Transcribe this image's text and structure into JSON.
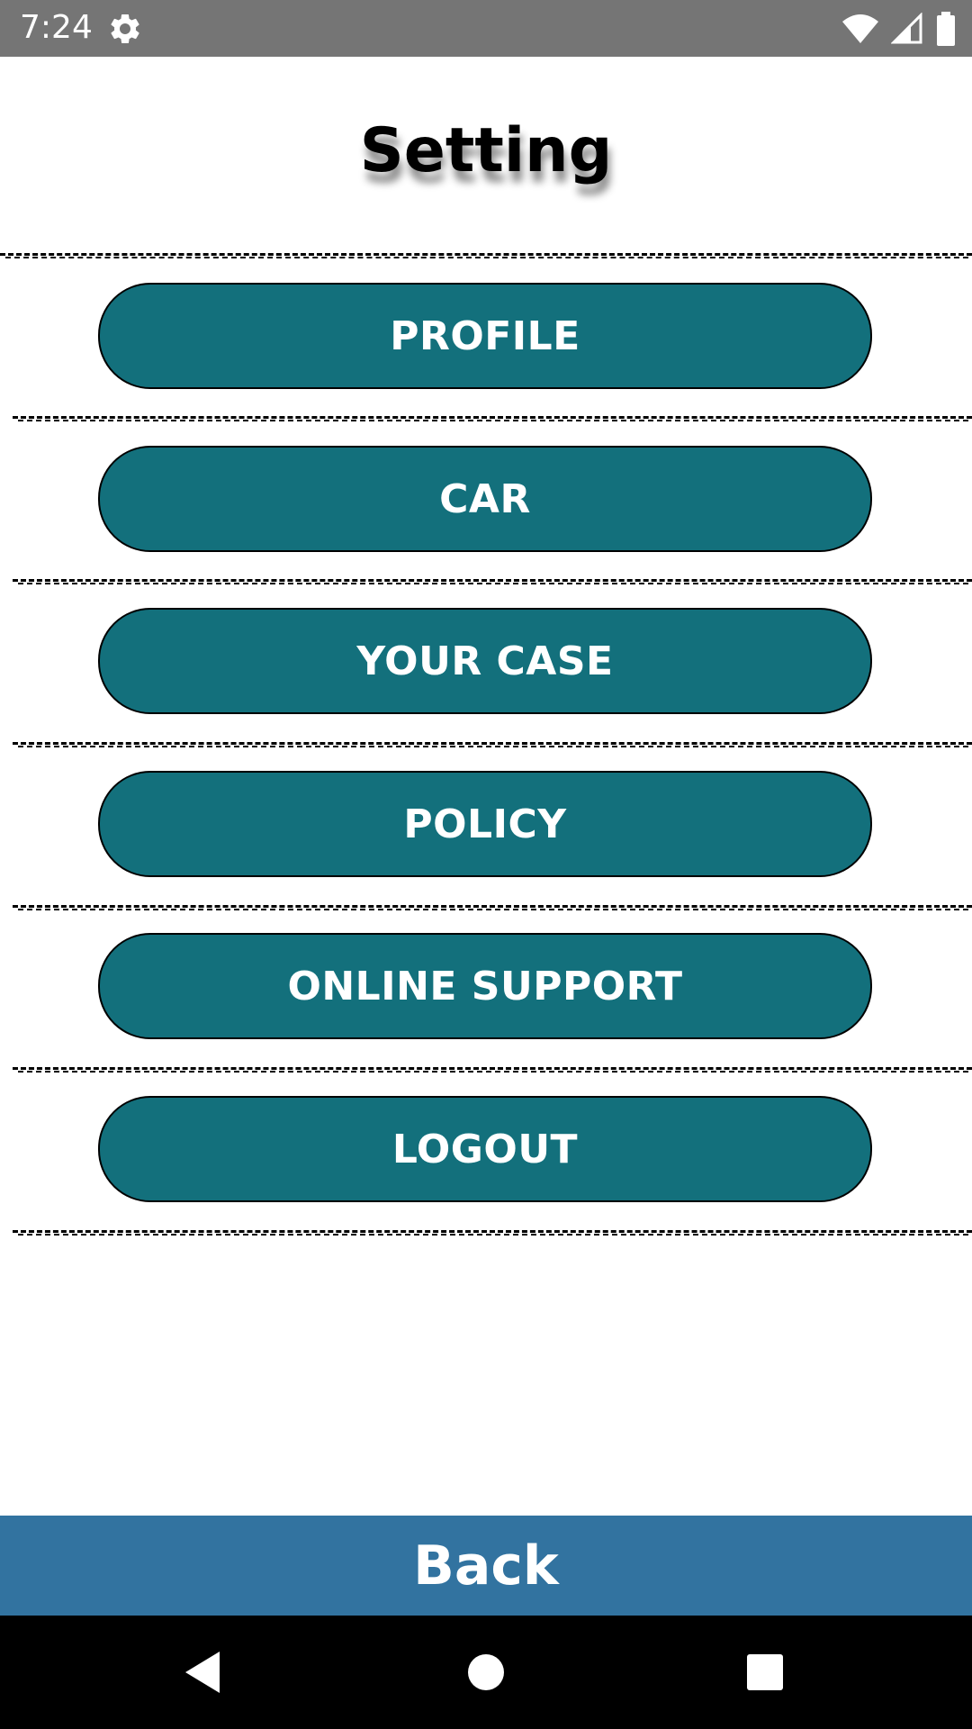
{
  "status_bar": {
    "time": "7:24",
    "icons": [
      "gear-icon",
      "wifi-icon",
      "cell-signal-icon",
      "battery-icon"
    ]
  },
  "page": {
    "title": "Setting"
  },
  "menu": {
    "items": [
      {
        "label": "PROFILE"
      },
      {
        "label": "CAR"
      },
      {
        "label": "YOUR CASE"
      },
      {
        "label": "POLICY"
      },
      {
        "label": "ONLINE SUPPORT"
      },
      {
        "label": "LOGOUT"
      }
    ]
  },
  "footer": {
    "back_label": "Back"
  },
  "nav": {
    "icons": [
      "back-triangle-icon",
      "home-circle-icon",
      "recents-square-icon"
    ]
  },
  "colors": {
    "status_bar": "#757575",
    "button": "#13707c",
    "back_bar": "#3273a0",
    "nav_bar": "#000000"
  }
}
